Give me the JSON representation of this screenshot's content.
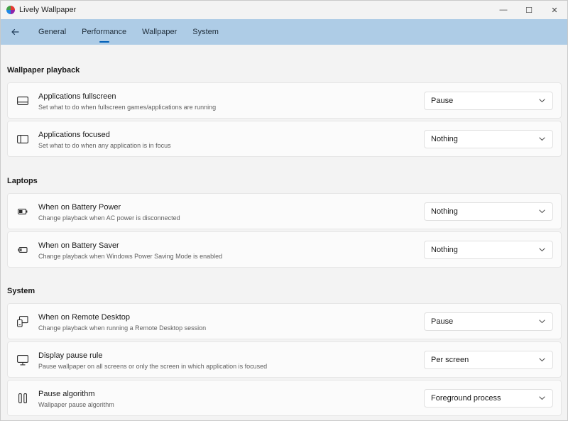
{
  "window": {
    "title": "Lively Wallpaper",
    "minimize_glyph": "—",
    "maximize_glyph": "☐",
    "close_glyph": "✕"
  },
  "nav": {
    "tabs": [
      {
        "label": "General"
      },
      {
        "label": "Performance",
        "active": true
      },
      {
        "label": "Wallpaper"
      },
      {
        "label": "System"
      }
    ]
  },
  "sections": {
    "playback": {
      "title": "Wallpaper playback",
      "items": [
        {
          "icon": "fullscreen-icon",
          "title": "Applications fullscreen",
          "desc": "Set what to do when fullscreen games/applications are running",
          "value": "Pause"
        },
        {
          "icon": "focused-window-icon",
          "title": "Applications focused",
          "desc": "Set what to do when any application is in focus",
          "value": "Nothing"
        }
      ]
    },
    "laptops": {
      "title": "Laptops",
      "items": [
        {
          "icon": "battery-icon",
          "title": "When on Battery Power",
          "desc": "Change playback when AC power is disconnected",
          "value": "Nothing"
        },
        {
          "icon": "battery-saver-icon",
          "title": "When on Battery Saver",
          "desc": "Change playback when Windows Power Saving Mode is enabled",
          "value": "Nothing"
        }
      ]
    },
    "system": {
      "title": "System",
      "items": [
        {
          "icon": "remote-desktop-icon",
          "title": "When on Remote Desktop",
          "desc": "Change playback when running a Remote Desktop session",
          "value": "Pause"
        },
        {
          "icon": "monitor-icon",
          "title": "Display pause rule",
          "desc": "Pause wallpaper on all screens or only the screen in which application is focused",
          "value": "Per screen"
        },
        {
          "icon": "pause-icon",
          "title": "Pause algorithm",
          "desc": "Wallpaper pause algorithm",
          "value": "Foreground process"
        }
      ]
    }
  }
}
